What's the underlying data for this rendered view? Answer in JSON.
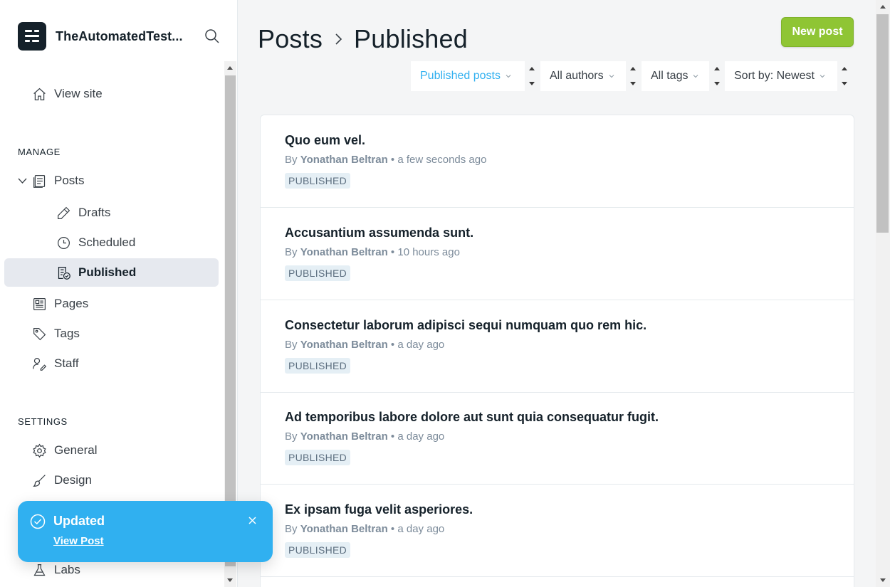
{
  "sidebar": {
    "site_name": "TheAutomatedTest...",
    "view_site": "View site",
    "manage_title": "MANAGE",
    "posts": "Posts",
    "drafts": "Drafts",
    "scheduled": "Scheduled",
    "published": "Published",
    "pages": "Pages",
    "tags": "Tags",
    "staff": "Staff",
    "settings_title": "SETTINGS",
    "general": "General",
    "design": "Design",
    "labs": "Labs"
  },
  "header": {
    "crumb_parent": "Posts",
    "crumb_current": "Published",
    "new_post": "New post"
  },
  "filters": {
    "type": "Published posts",
    "authors": "All authors",
    "tags": "All tags",
    "sort": "Sort by: Newest"
  },
  "posts": [
    {
      "title": "Quo eum vel.",
      "by": "By",
      "author": "Yonathan Beltran",
      "time": "a few seconds ago",
      "status": "PUBLISHED"
    },
    {
      "title": "Accusantium assumenda sunt.",
      "by": "By",
      "author": "Yonathan Beltran",
      "time": "10 hours ago",
      "status": "PUBLISHED"
    },
    {
      "title": "Consectetur laborum adipisci sequi numquam quo rem hic.",
      "by": "By",
      "author": "Yonathan Beltran",
      "time": "a day ago",
      "status": "PUBLISHED"
    },
    {
      "title": "Ad temporibus labore dolore aut sunt quia consequatur fugit.",
      "by": "By",
      "author": "Yonathan Beltran",
      "time": "a day ago",
      "status": "PUBLISHED"
    },
    {
      "title": "Ex ipsam fuga velit asperiores.",
      "by": "By",
      "author": "Yonathan Beltran",
      "time": "a day ago",
      "status": "PUBLISHED"
    }
  ],
  "toast": {
    "title": "Updated",
    "link": "View Post"
  },
  "colors": {
    "accent_green": "#8fc534",
    "toast_blue": "#30b0f0",
    "filter_active": "#30b0f0"
  }
}
